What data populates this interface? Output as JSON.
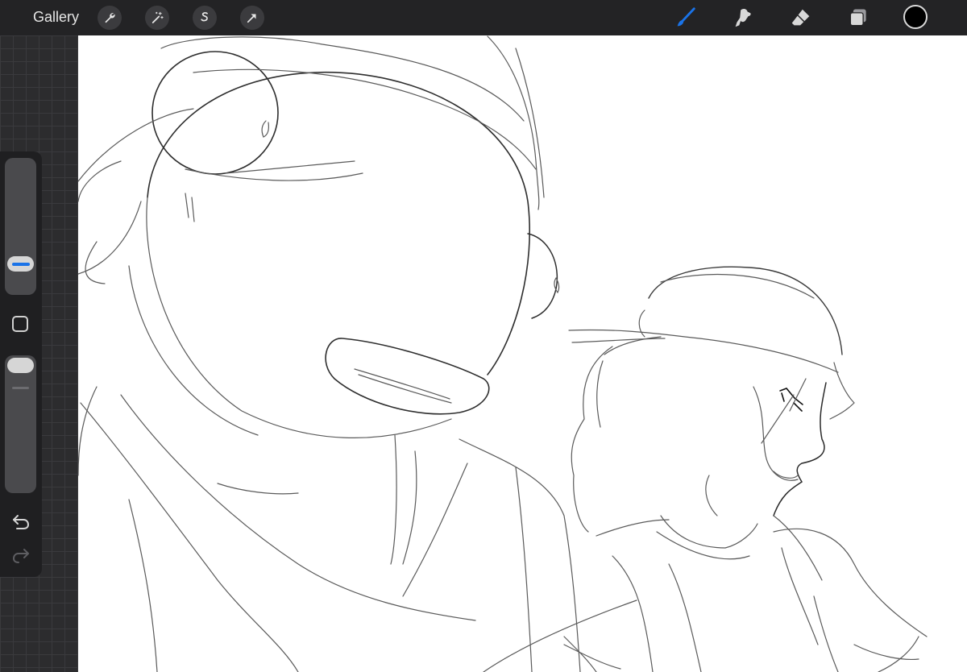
{
  "topbar": {
    "gallery_label": "Gallery",
    "left_tools": [
      "wrench-icon",
      "magic-wand-icon",
      "selection-icon",
      "transform-arrow-icon"
    ],
    "right_tools": [
      "brush-icon",
      "smudge-icon",
      "eraser-icon",
      "layers-icon"
    ],
    "active_tool": "brush-icon",
    "current_color": "#000000",
    "accent_color": "#1a73e8"
  },
  "sidebar": {
    "brush_size_level": 0.34,
    "opacity_level": 1.0,
    "buttons": [
      "modify-square-icon",
      "undo-icon",
      "redo-icon"
    ]
  }
}
